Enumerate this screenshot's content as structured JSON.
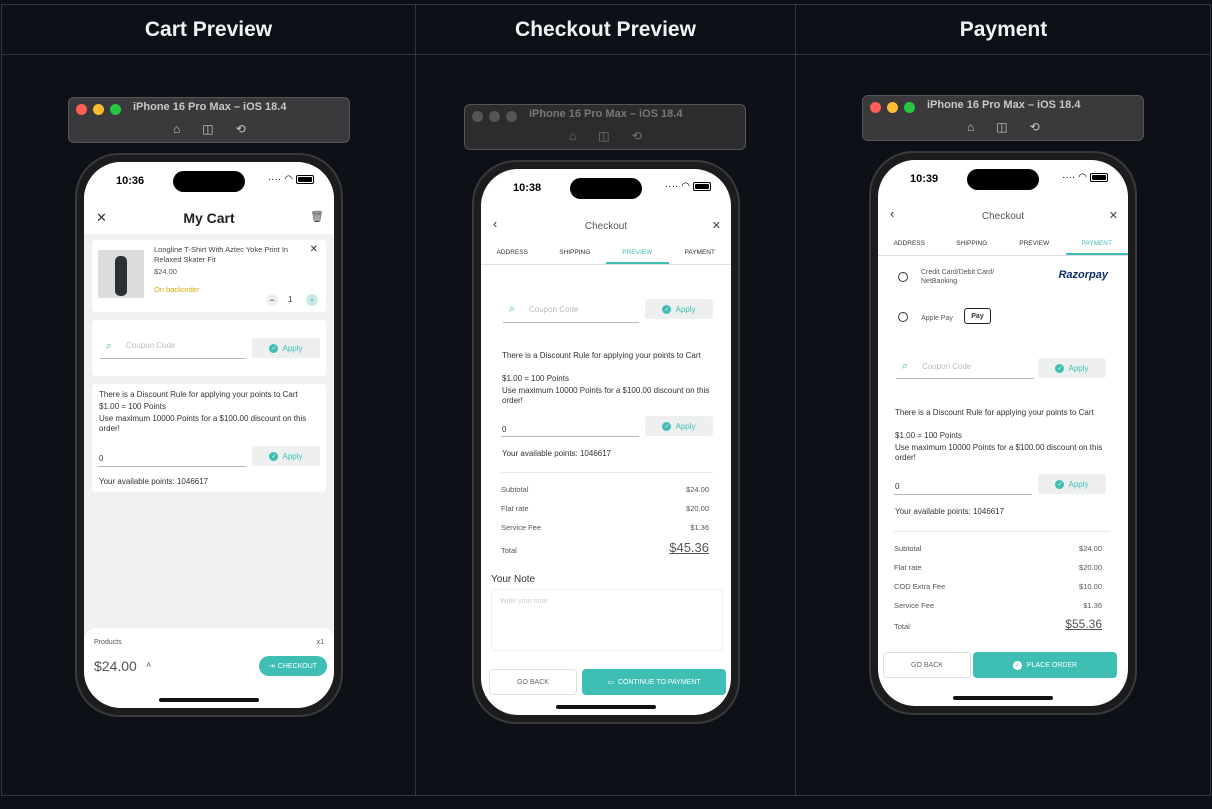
{
  "columns": [
    "Cart Preview",
    "Checkout Preview",
    "Payment"
  ],
  "simulator": {
    "title": "iPhone 16 Pro Max – iOS 18.4",
    "colors": {
      "close": "#ff5f57",
      "minimize": "#febc2e",
      "zoom": "#28c840"
    }
  },
  "accent_color": "#3fbfb4",
  "cart": {
    "time": "10:36",
    "title": "My Cart",
    "item": {
      "name": "Longline T-Shirt With Aztec Yoke Print In Relaxed Skater Fit",
      "price": "$24.00",
      "status": "On backorder",
      "qty": "1"
    },
    "coupon_placeholder": "Coupon Code",
    "apply": "Apply",
    "discount_rule": "There is a Discount Rule for applying your points to Cart",
    "rate": "$1.00 = 100 Points",
    "max_points": "Use maximum 10000 Points for a $100.00 discount on this order!",
    "points_value": "0",
    "available_points": "Your available points: 1046617",
    "products_label": "Products",
    "products_count": "x1",
    "total": "$24.00",
    "checkout": "CHECKOUT"
  },
  "checkout": {
    "time": "10:38",
    "title": "Checkout",
    "tabs": [
      "ADDRESS",
      "SHIPPING",
      "PREVIEW",
      "PAYMENT"
    ],
    "coupon_placeholder": "Coupon Code",
    "apply": "Apply",
    "discount_rule": "There is a Discount Rule for applying your points to Cart",
    "rate": "$1.00 = 100 Points",
    "max_points": "Use maximum 10000 Points for a $100.00 discount on this order!",
    "points_value": "0",
    "available_points": "Your available points: 1046617",
    "summary": [
      {
        "label": "Subtotal",
        "value": "$24.00"
      },
      {
        "label": "Flat rate",
        "value": "$20.00"
      },
      {
        "label": "Service Fee",
        "value": "$1.36"
      }
    ],
    "total_label": "Total",
    "total": "$45.36",
    "note_title": "Your Note",
    "note_placeholder": "Write your note",
    "go_back": "GO BACK",
    "continue": "CONTINUE TO PAYMENT"
  },
  "payment": {
    "time": "10:39",
    "title": "Checkout",
    "tabs": [
      "ADDRESS",
      "SHIPPING",
      "PREVIEW",
      "PAYMENT"
    ],
    "methods": [
      {
        "label": "Credit Card/Debit Card/ NetBanking",
        "brand": "Razorpay"
      },
      {
        "label": "Apple Pay",
        "brand": "Pay"
      }
    ],
    "coupon_placeholder": "Coupon Code",
    "apply": "Apply",
    "discount_rule": "There is a Discount Rule for applying your points to Cart",
    "rate": "$1.00 = 100 Points",
    "max_points": "Use maximum 10000 Points for a $100.00 discount on this order!",
    "points_value": "0",
    "available_points": "Your available points: 1046617",
    "summary": [
      {
        "label": "Subtotal",
        "value": "$24.00"
      },
      {
        "label": "Flat rate",
        "value": "$20.00"
      },
      {
        "label": "COD Extra Fee",
        "value": "$10.00"
      },
      {
        "label": "Service Fee",
        "value": "$1.36"
      }
    ],
    "total_label": "Total",
    "total": "$55.36",
    "go_back": "GO BACK",
    "place_order": "PLACE ORDER"
  }
}
